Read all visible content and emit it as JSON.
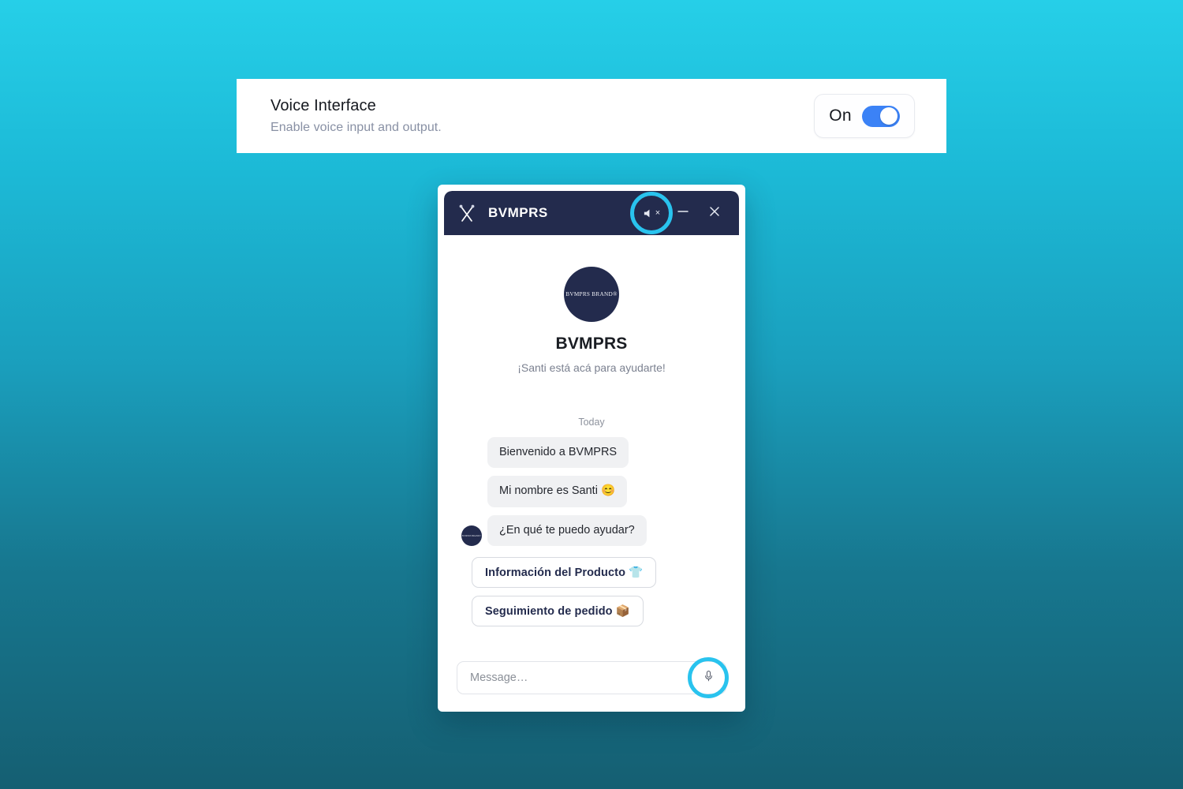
{
  "background": {
    "gradient_from": "#26cfe8",
    "gradient_to": "#155f72"
  },
  "settings": {
    "title": "Voice Interface",
    "description": "Enable voice input and output.",
    "toggle": {
      "state_label": "On",
      "enabled": true,
      "accent_color": "#3b82f6"
    }
  },
  "widget": {
    "header": {
      "title": "BVMPRS",
      "logo_name": "crossed-arrows-logo",
      "mute_label": "×",
      "highlight_color": "#29c3ee",
      "background_color": "#232b4d"
    },
    "intro": {
      "avatar_text": "BVMPRS BRAND®",
      "brand_name": "BVMPRS",
      "subtitle": "¡Santi está acá para ayudarte!"
    },
    "day_label": "Today",
    "messages": [
      {
        "text": "Bienvenido a BVMPRS",
        "has_avatar": false
      },
      {
        "text": "Mi nombre es Santi 😊",
        "has_avatar": false
      },
      {
        "text": "¿En qué te puedo ayudar?",
        "has_avatar": true
      }
    ],
    "message_avatar_text": "BVMPRS BRAND®",
    "quick_replies": [
      {
        "label": "Información del Producto 👕"
      },
      {
        "label": "Seguimiento de pedido 📦"
      }
    ],
    "composer": {
      "placeholder": "Message…",
      "value": "",
      "mic_highlight_color": "#29c3ee"
    }
  }
}
